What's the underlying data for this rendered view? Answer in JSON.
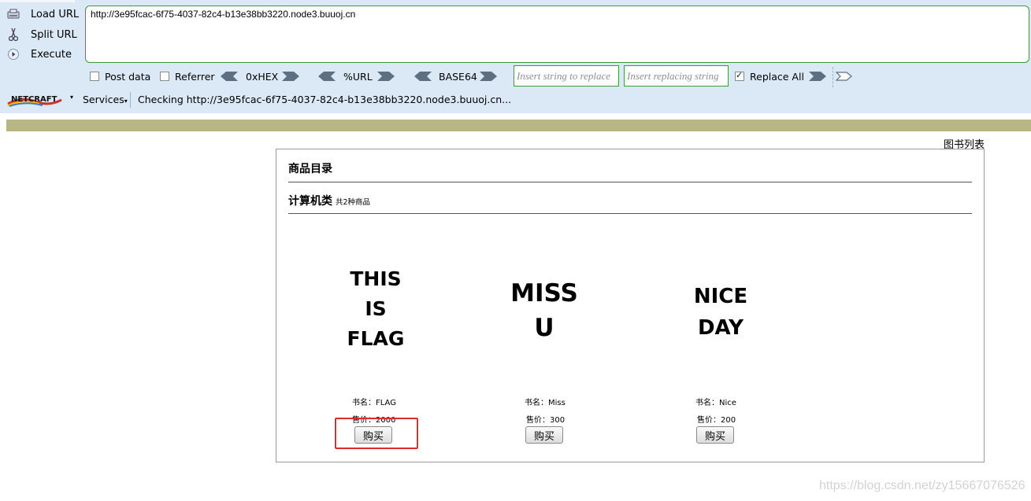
{
  "hackbar": {
    "load_url": "Load URL",
    "split_url": "Split URL",
    "execute": "Execute",
    "url_value": "http://3e95fcac-6f75-4037-82c4-b13e38bb3220.node3.buuoj.cn",
    "post_data": "Post data",
    "post_data_checked": false,
    "referrer": "Referrer",
    "referrer_checked": false,
    "hex": "0xHEX",
    "url_enc": "%URL",
    "base64": "BASE64",
    "insert_replace_placeholder": "Insert string to replace",
    "insert_replacing_placeholder": "Insert replacing string",
    "replace_all": "Replace All",
    "replace_all_checked": true
  },
  "netcraft": {
    "logo_text": "NETCRAFT",
    "services": "Services",
    "status": "Checking http://3e95fcac-6f75-4037-82c4-b13e38bb3220.node3.buuoj.cn..."
  },
  "page": {
    "book_list": "图书列表",
    "catalog_title": "商品目录",
    "category": "计算机类",
    "category_count": "共2种商品",
    "products": [
      {
        "cover_lines": [
          "THIS",
          "IS",
          "FLAG"
        ],
        "name_label": "书名：FLAG",
        "price_label": "售价：2000",
        "buy": "购买"
      },
      {
        "cover_lines": [
          "MISS",
          "U"
        ],
        "name_label": "书名：Miss",
        "price_label": "售价：300",
        "buy": "购买"
      },
      {
        "cover_lines": [
          "NICE",
          "DAY"
        ],
        "name_label": "书名：Nice",
        "price_label": "售价：200",
        "buy": "购买"
      }
    ]
  },
  "watermark": "https://blog.csdn.net/zy15667076526",
  "colors": {
    "accent_green": "#3b9a3b",
    "toolbar_bg": "#dbe8f6",
    "olive": "#b8b684",
    "highlight_red": "#e32a2a"
  }
}
